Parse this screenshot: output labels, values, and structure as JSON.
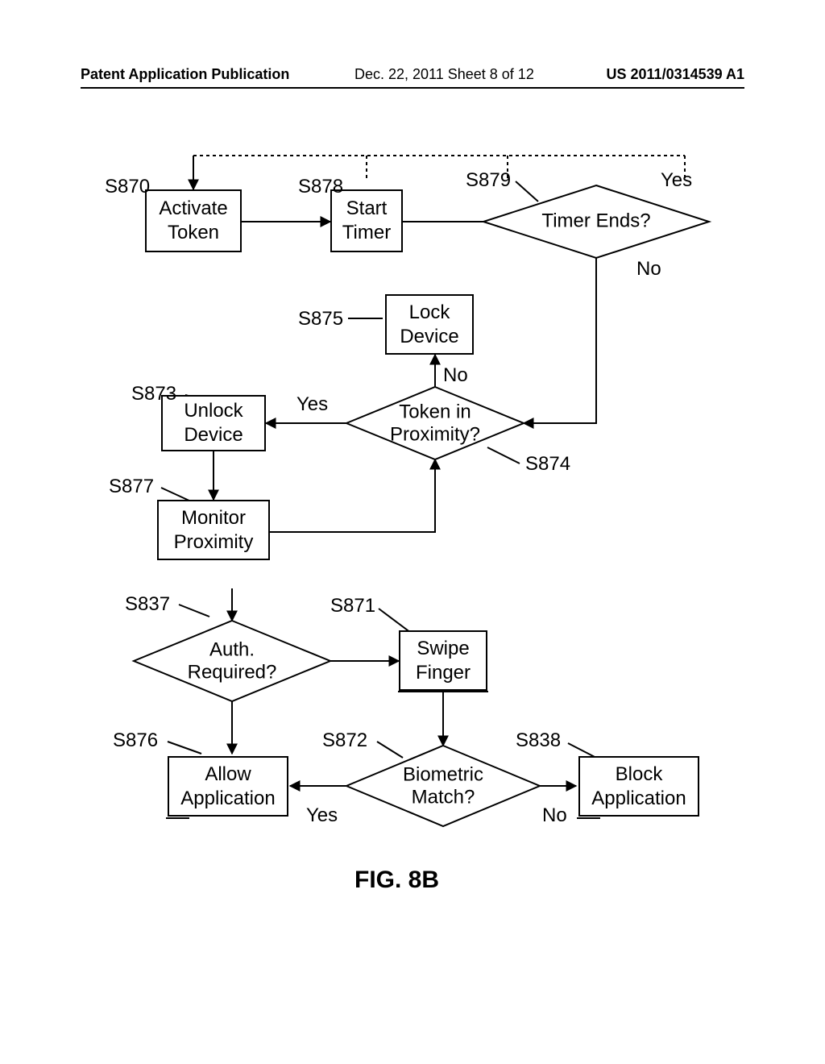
{
  "header": {
    "left": "Patent Application Publication",
    "center": "Dec. 22, 2011  Sheet 8 of 12",
    "right": "US 2011/0314539 A1"
  },
  "figcap": "FIG. 8B",
  "lbl": {
    "s870": "S870",
    "s878": "S878",
    "s879": "S879",
    "s875": "S875",
    "s873": "S873",
    "s874": "S874",
    "s877": "S877",
    "s837": "S837",
    "s871": "S871",
    "s876": "S876",
    "s872": "S872",
    "s838": "S838",
    "yes879": "Yes",
    "no879": "No",
    "no874": "No",
    "yes874": "Yes",
    "yes872": "Yes",
    "no872": "No"
  },
  "box": {
    "activate": "Activate\nToken",
    "start": "Start\nTimer",
    "lock": "Lock\nDevice",
    "unlock": "Unlock\nDevice",
    "monitor": "Monitor\nProximity",
    "swipe": "Swipe\nFinger",
    "allow": "Allow\nApplication",
    "block": "Block\nApplication"
  },
  "dia": {
    "timer": "Timer Ends?",
    "token_l1": "Token in",
    "token_l2": "Proximity?",
    "auth_l1": "Auth.",
    "auth_l2": "Required?",
    "bio_l1": "Biometric",
    "bio_l2": "Match?"
  }
}
